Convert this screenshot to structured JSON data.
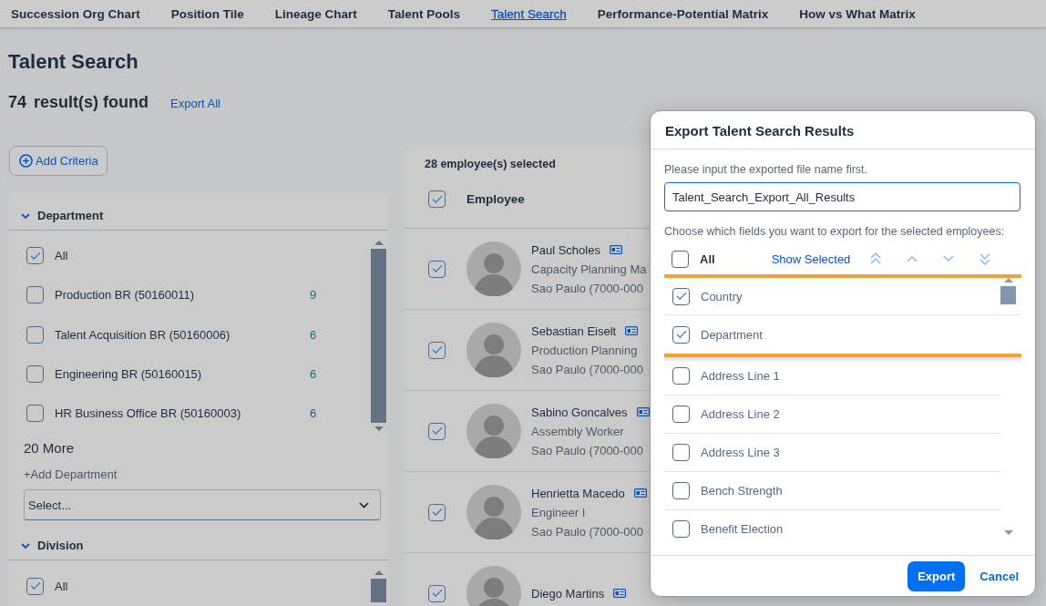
{
  "nav": [
    {
      "label": "Succession Org Chart",
      "selected": false
    },
    {
      "label": "Position Tile",
      "selected": false
    },
    {
      "label": "Lineage Chart",
      "selected": false
    },
    {
      "label": "Talent Pools",
      "selected": false
    },
    {
      "label": "Talent Search",
      "selected": true
    },
    {
      "label": "Performance-Potential Matrix",
      "selected": false
    },
    {
      "label": "How vs What Matrix",
      "selected": false
    }
  ],
  "page_title": "Talent Search",
  "result_count": "74",
  "result_label": "result(s) found",
  "export_all": "Export All",
  "add_criteria": "Add Criteria",
  "filters": [
    {
      "title": "Department",
      "expanded": true,
      "items": [
        {
          "label": "All",
          "checked": true
        },
        {
          "label": "Production BR (50160011)",
          "checked": false,
          "count": "9"
        },
        {
          "label": "Talent Acquisition BR (50160006)",
          "checked": false,
          "count": "6"
        },
        {
          "label": "Engineering BR (50160015)",
          "checked": false,
          "count": "6"
        },
        {
          "label": "HR Business Office BR (50160003)",
          "checked": false,
          "count": "6"
        }
      ],
      "more": "20 More",
      "add_link": "+Add Department",
      "select_placeholder": "Select..."
    },
    {
      "title": "Division",
      "expanded": true,
      "items": [
        {
          "label": "All",
          "checked": true
        }
      ]
    }
  ],
  "employees": {
    "selected_count": "28 employee(s) selected",
    "all_checked": true,
    "column": "Employee",
    "rows": [
      {
        "name": "Paul Scholes",
        "checked": true,
        "title": "Capacity Planning Ma",
        "location": "Sao Paulo (7000-000"
      },
      {
        "name": "Sebastian Eiselt",
        "checked": true,
        "title": "Production Planning",
        "location": "Sao Paulo (7000-000"
      },
      {
        "name": "Sabino Goncalves",
        "checked": true,
        "title": "Assembly Worker",
        "location": "Sao Paulo (7000-000"
      },
      {
        "name": "Henrietta Macedo",
        "checked": true,
        "title": "Engineer I",
        "location": "Sao Paulo (7000-000"
      },
      {
        "name": "Diego Martins",
        "checked": true
      }
    ]
  },
  "dialog": {
    "title": "Export Talent Search Results",
    "file_label": "Please input the exported file name first.",
    "file_name": "Talent_Search_Export_All_Results",
    "fields_label": "Choose which fields you want to export for the selected employees:",
    "all_checked": false,
    "all_label": "All",
    "show_selected": "Show Selected",
    "fields": [
      {
        "label": "Country",
        "checked": true,
        "highlighted": true
      },
      {
        "label": "Department",
        "checked": true,
        "highlighted": true
      },
      {
        "label": "Address Line 1",
        "checked": false,
        "highlighted": false
      },
      {
        "label": "Address Line 2",
        "checked": false,
        "highlighted": false
      },
      {
        "label": "Address Line 3",
        "checked": false,
        "highlighted": false
      },
      {
        "label": "Bench Strength",
        "checked": false,
        "highlighted": false
      },
      {
        "label": "Benefit Election",
        "checked": false,
        "highlighted": false
      }
    ],
    "buttons": [
      {
        "label": "Export",
        "kind": "primary"
      },
      {
        "label": "Cancel",
        "kind": "link"
      }
    ]
  }
}
